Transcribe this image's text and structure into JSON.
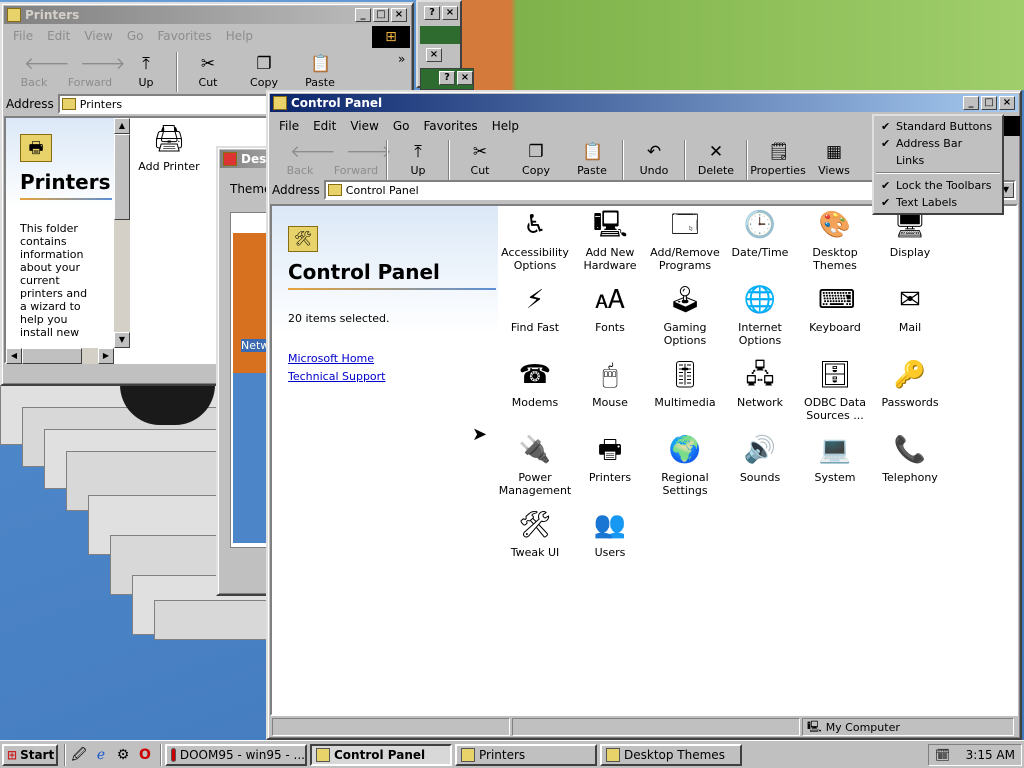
{
  "printers": {
    "title": "Printers",
    "menu": [
      "File",
      "Edit",
      "View",
      "Go",
      "Favorites",
      "Help"
    ],
    "toolbar": [
      {
        "label": "Back",
        "icon": "back-arrow-icon",
        "glyph": "🡐",
        "disabled": true
      },
      {
        "label": "Forward",
        "icon": "forward-arrow-icon",
        "glyph": "🡒",
        "disabled": true
      },
      {
        "label": "Up",
        "icon": "up-folder-icon",
        "glyph": "⤒",
        "disabled": false
      },
      {
        "label": "Cut",
        "icon": "scissors-icon",
        "glyph": "✂",
        "disabled": false
      },
      {
        "label": "Copy",
        "icon": "copy-icon",
        "glyph": "❐",
        "disabled": false
      },
      {
        "label": "Paste",
        "icon": "paste-icon",
        "glyph": "📋",
        "disabled": false
      }
    ],
    "address_label": "Address",
    "address_value": "Printers",
    "heading": "Printers",
    "description": "This folder contains information about your current printers and a wizard to help you install new ones.",
    "items": [
      {
        "label": "Add Printer",
        "icon": "add-printer-icon"
      }
    ]
  },
  "desktop_themes": {
    "title": "Desk",
    "theme_label": "Theme:",
    "preview_fragment": "Netw"
  },
  "control_panel": {
    "title": "Control Panel",
    "menu": [
      "File",
      "Edit",
      "View",
      "Go",
      "Favorites",
      "Help"
    ],
    "toolbar": [
      {
        "label": "Back",
        "icon": "back-arrow-icon",
        "glyph": "🡐",
        "disabled": true
      },
      {
        "label": "Forward",
        "icon": "forward-arrow-icon",
        "glyph": "🡒",
        "disabled": true
      },
      {
        "label": "Up",
        "icon": "up-folder-icon",
        "glyph": "⤒",
        "disabled": false
      },
      {
        "label": "Cut",
        "icon": "scissors-icon",
        "glyph": "✂",
        "disabled": false
      },
      {
        "label": "Copy",
        "icon": "copy-icon",
        "glyph": "❐",
        "disabled": false
      },
      {
        "label": "Paste",
        "icon": "paste-icon",
        "glyph": "📋",
        "disabled": false
      },
      {
        "label": "Undo",
        "icon": "undo-icon",
        "glyph": "↶",
        "disabled": false
      },
      {
        "label": "Delete",
        "icon": "delete-icon",
        "glyph": "✕",
        "disabled": false
      },
      {
        "label": "Properties",
        "icon": "properties-icon",
        "glyph": "🗒",
        "disabled": false
      },
      {
        "label": "Views",
        "icon": "views-icon",
        "glyph": "▦",
        "disabled": false
      }
    ],
    "address_label": "Address",
    "address_value": "Control Panel",
    "heading": "Control Panel",
    "selection_text": "20 items selected.",
    "links": [
      "Microsoft Home",
      "Technical Support"
    ],
    "items": [
      {
        "label": "Accessibility Options",
        "icon": "accessibility-icon",
        "glyph": "♿"
      },
      {
        "label": "Add New Hardware",
        "icon": "add-hardware-icon",
        "glyph": "🖳"
      },
      {
        "label": "Add/Remove Programs",
        "icon": "add-remove-programs-icon",
        "glyph": "🗔"
      },
      {
        "label": "Date/Time",
        "icon": "clock-icon",
        "glyph": "🕒"
      },
      {
        "label": "Desktop Themes",
        "icon": "desktop-themes-icon",
        "glyph": "🎨"
      },
      {
        "label": "Display",
        "icon": "display-icon",
        "glyph": "🖥"
      },
      {
        "label": "Find Fast",
        "icon": "find-fast-icon",
        "glyph": "⚡"
      },
      {
        "label": "Fonts",
        "icon": "fonts-icon",
        "glyph": "🗚"
      },
      {
        "label": "Gaming Options",
        "icon": "joystick-icon",
        "glyph": "🕹"
      },
      {
        "label": "Internet Options",
        "icon": "internet-icon",
        "glyph": "🌐"
      },
      {
        "label": "Keyboard",
        "icon": "keyboard-icon",
        "glyph": "⌨"
      },
      {
        "label": "Mail",
        "icon": "mail-icon",
        "glyph": "✉"
      },
      {
        "label": "Modems",
        "icon": "modem-icon",
        "glyph": "☎"
      },
      {
        "label": "Mouse",
        "icon": "mouse-icon",
        "glyph": "🖱"
      },
      {
        "label": "Multimedia",
        "icon": "multimedia-icon",
        "glyph": "🎚"
      },
      {
        "label": "Network",
        "icon": "network-icon",
        "glyph": "🖧"
      },
      {
        "label": "ODBC Data Sources ...",
        "icon": "odbc-icon",
        "glyph": "🗄"
      },
      {
        "label": "Passwords",
        "icon": "keys-icon",
        "glyph": "🔑"
      },
      {
        "label": "Power Management",
        "icon": "power-icon",
        "glyph": "🔌"
      },
      {
        "label": "Printers",
        "icon": "printer-folder-icon",
        "glyph": "🖶"
      },
      {
        "label": "Regional Settings",
        "icon": "globe-icon",
        "glyph": "🌍"
      },
      {
        "label": "Sounds",
        "icon": "sound-icon",
        "glyph": "🔊"
      },
      {
        "label": "System",
        "icon": "computer-icon",
        "glyph": "💻"
      },
      {
        "label": "Telephony",
        "icon": "telephony-icon",
        "glyph": "📞"
      },
      {
        "label": "Tweak UI",
        "icon": "tweak-ui-icon",
        "glyph": "🛠"
      },
      {
        "label": "Users",
        "icon": "users-icon",
        "glyph": "👥"
      }
    ],
    "status_location": "My Computer"
  },
  "toolbars_menu": [
    {
      "label": "Standard Buttons",
      "checked": true
    },
    {
      "label": "Address Bar",
      "checked": true
    },
    {
      "label": "Links",
      "checked": false
    },
    {
      "label": "Lock the Toolbars",
      "checked": true,
      "separator_before": true
    },
    {
      "label": "Text Labels",
      "checked": true
    }
  ],
  "taskbar": {
    "start_label": "Start",
    "buttons": [
      {
        "label": "DOOM95 - win95 - ...",
        "icon": "opera-icon",
        "pressed": false
      },
      {
        "label": "Control Panel",
        "icon": "control-panel-icon",
        "pressed": true
      },
      {
        "label": "Printers",
        "icon": "printers-icon",
        "pressed": false
      },
      {
        "label": "Desktop Themes",
        "icon": "desktop-themes-icon",
        "pressed": false
      }
    ],
    "clock": "3:15 AM"
  }
}
